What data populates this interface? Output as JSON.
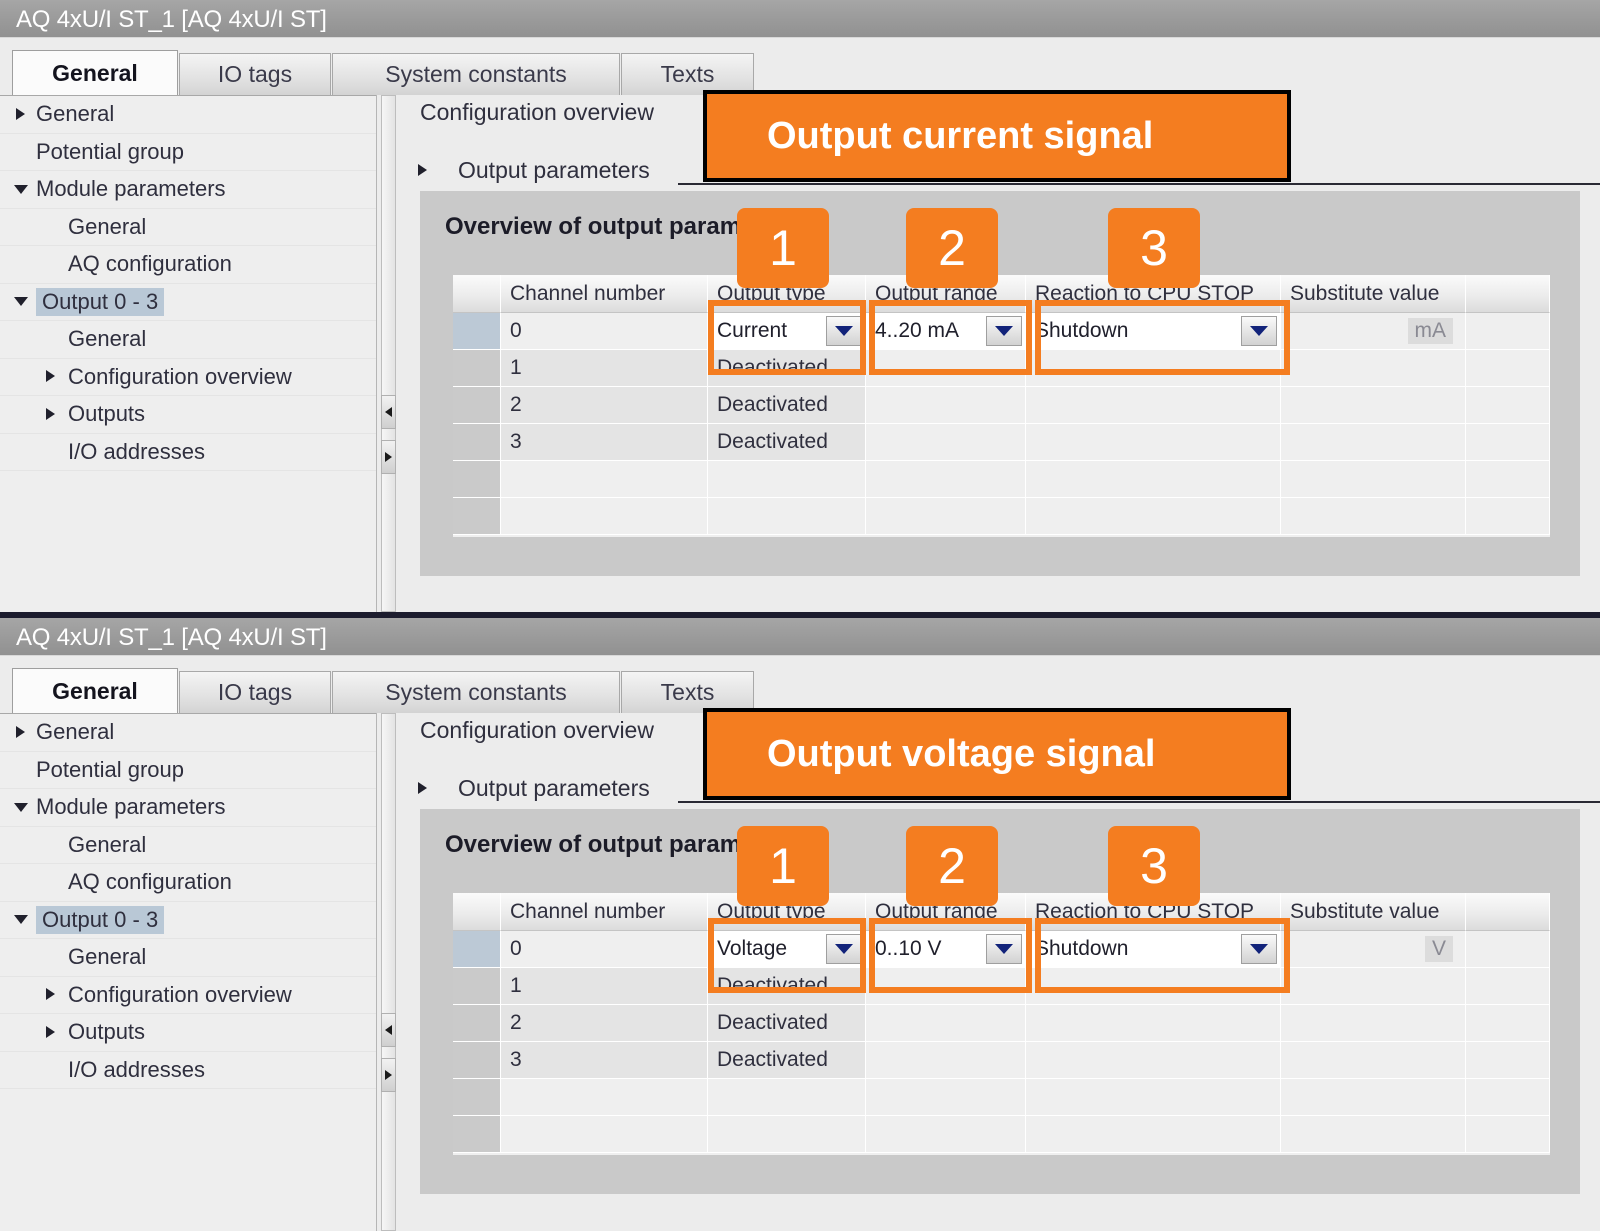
{
  "panels": [
    {
      "title": "AQ 4xU/I ST_1 [AQ 4xU/I ST]",
      "tabs": [
        {
          "label": "General",
          "active": true
        },
        {
          "label": "IO tags",
          "active": false
        },
        {
          "label": "System constants",
          "active": false
        },
        {
          "label": "Texts",
          "active": false
        }
      ],
      "tree": [
        {
          "label": "General",
          "arrow": "right",
          "indent": 36,
          "selected": false
        },
        {
          "label": "Potential group",
          "arrow": "none",
          "indent": 36,
          "selected": false
        },
        {
          "label": "Module parameters",
          "arrow": "down",
          "indent": 36,
          "selected": false
        },
        {
          "label": "General",
          "arrow": "none",
          "indent": 68,
          "selected": false
        },
        {
          "label": "AQ configuration",
          "arrow": "none",
          "indent": 68,
          "selected": false
        },
        {
          "label": "Output 0 - 3",
          "arrow": "down",
          "indent": 36,
          "selected": true
        },
        {
          "label": "General",
          "arrow": "none",
          "indent": 68,
          "selected": false
        },
        {
          "label": "Configuration overview",
          "arrow": "right",
          "indent": 68,
          "selected": false
        },
        {
          "label": "Outputs",
          "arrow": "right",
          "indent": 68,
          "selected": false
        },
        {
          "label": "I/O addresses",
          "arrow": "none",
          "indent": 68,
          "selected": false
        }
      ],
      "content": {
        "heading": "Configuration overview",
        "section": "Output parameters",
        "group_title": "Overview of output parameters"
      },
      "table": {
        "headers": [
          "",
          "Channel number",
          "Output type",
          "Output range",
          "Reaction to CPU STOP",
          "Substitute value",
          ""
        ],
        "rows": [
          {
            "channel": "0",
            "output_type": "Current",
            "output_range": "4..20 mA",
            "reaction": "Shutdown",
            "substitute_unit": "mA",
            "editable": true
          },
          {
            "channel": "1",
            "output_type": "Deactivated",
            "output_range": "",
            "reaction": "",
            "substitute_unit": "",
            "editable": false
          },
          {
            "channel": "2",
            "output_type": "Deactivated",
            "output_range": "",
            "reaction": "",
            "substitute_unit": "",
            "editable": false
          },
          {
            "channel": "3",
            "output_type": "Deactivated",
            "output_range": "",
            "reaction": "",
            "substitute_unit": "",
            "editable": false
          },
          {
            "channel": "",
            "output_type": "",
            "output_range": "",
            "reaction": "",
            "substitute_unit": "",
            "editable": false
          },
          {
            "channel": "",
            "output_type": "",
            "output_range": "",
            "reaction": "",
            "substitute_unit": "",
            "editable": false
          }
        ]
      },
      "annotation": {
        "callout": "Output current signal",
        "badges": [
          "1",
          "2",
          "3"
        ]
      }
    },
    {
      "title": "AQ 4xU/I ST_1 [AQ 4xU/I ST]",
      "tabs": [
        {
          "label": "General",
          "active": true
        },
        {
          "label": "IO tags",
          "active": false
        },
        {
          "label": "System constants",
          "active": false
        },
        {
          "label": "Texts",
          "active": false
        }
      ],
      "tree": [
        {
          "label": "General",
          "arrow": "right",
          "indent": 36,
          "selected": false
        },
        {
          "label": "Potential group",
          "arrow": "none",
          "indent": 36,
          "selected": false
        },
        {
          "label": "Module parameters",
          "arrow": "down",
          "indent": 36,
          "selected": false
        },
        {
          "label": "General",
          "arrow": "none",
          "indent": 68,
          "selected": false
        },
        {
          "label": "AQ configuration",
          "arrow": "none",
          "indent": 68,
          "selected": false
        },
        {
          "label": "Output 0 - 3",
          "arrow": "down",
          "indent": 36,
          "selected": true
        },
        {
          "label": "General",
          "arrow": "none",
          "indent": 68,
          "selected": false
        },
        {
          "label": "Configuration overview",
          "arrow": "right",
          "indent": 68,
          "selected": false
        },
        {
          "label": "Outputs",
          "arrow": "right",
          "indent": 68,
          "selected": false
        },
        {
          "label": "I/O addresses",
          "arrow": "none",
          "indent": 68,
          "selected": false
        }
      ],
      "content": {
        "heading": "Configuration overview",
        "section": "Output parameters",
        "group_title": "Overview of output parameters"
      },
      "table": {
        "headers": [
          "",
          "Channel number",
          "Output type",
          "Output range",
          "Reaction to CPU STOP",
          "Substitute value",
          ""
        ],
        "rows": [
          {
            "channel": "0",
            "output_type": "Voltage",
            "output_range": "0..10 V",
            "reaction": "Shutdown",
            "substitute_unit": "V",
            "editable": true
          },
          {
            "channel": "1",
            "output_type": "Deactivated",
            "output_range": "",
            "reaction": "",
            "substitute_unit": "",
            "editable": false
          },
          {
            "channel": "2",
            "output_type": "Deactivated",
            "output_range": "",
            "reaction": "",
            "substitute_unit": "",
            "editable": false
          },
          {
            "channel": "3",
            "output_type": "Deactivated",
            "output_range": "",
            "reaction": "",
            "substitute_unit": "",
            "editable": false
          },
          {
            "channel": "",
            "output_type": "",
            "output_range": "",
            "reaction": "",
            "substitute_unit": "",
            "editable": false
          },
          {
            "channel": "",
            "output_type": "",
            "output_range": "",
            "reaction": "",
            "substitute_unit": "",
            "editable": false
          }
        ]
      },
      "annotation": {
        "callout": "Output voltage signal",
        "badges": [
          "1",
          "2",
          "3"
        ]
      }
    }
  ],
  "colors": {
    "accent_orange": "#f47d20",
    "titlebar_gray": "#9b9b9b",
    "selection_blue": "#b9c8d6",
    "dropdown_arrow": "#12237a"
  },
  "icons": {
    "tree_collapsed": "chevron-right-icon",
    "tree_expanded": "chevron-down-icon",
    "dropdown": "chevron-down-icon",
    "splitter_left": "arrow-left-icon",
    "splitter_right": "arrow-right-icon"
  }
}
